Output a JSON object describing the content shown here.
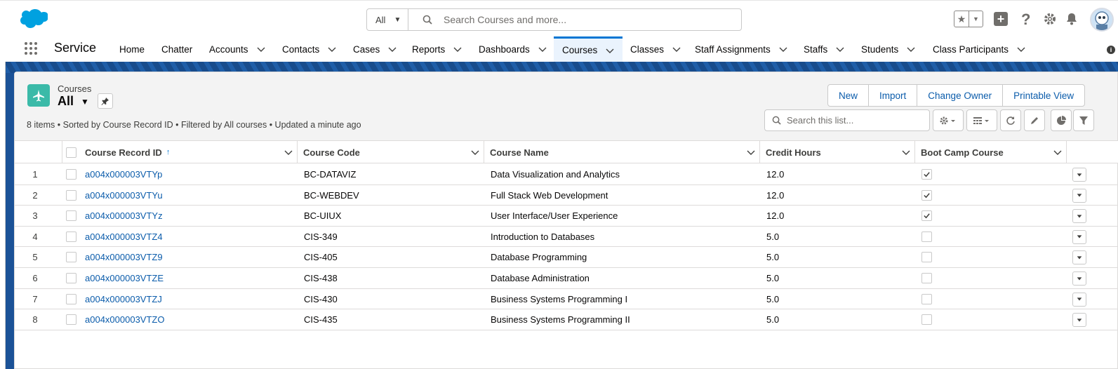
{
  "header": {
    "search_scope": "All",
    "search_placeholder": "Search Courses and more..."
  },
  "nav": {
    "app_name": "Service",
    "items": [
      {
        "label": "Home",
        "has_menu": false
      },
      {
        "label": "Chatter",
        "has_menu": false
      },
      {
        "label": "Accounts",
        "has_menu": true
      },
      {
        "label": "Contacts",
        "has_menu": true
      },
      {
        "label": "Cases",
        "has_menu": true
      },
      {
        "label": "Reports",
        "has_menu": true
      },
      {
        "label": "Dashboards",
        "has_menu": true
      },
      {
        "label": "Courses",
        "has_menu": true,
        "active": true
      },
      {
        "label": "Classes",
        "has_menu": true
      },
      {
        "label": "Staff Assignments",
        "has_menu": true
      },
      {
        "label": "Staffs",
        "has_menu": true
      },
      {
        "label": "Students",
        "has_menu": true
      },
      {
        "label": "Class Participants",
        "has_menu": true
      }
    ]
  },
  "list_view": {
    "object_label": "Courses",
    "view_name": "All",
    "meta": "8 items • Sorted by Course Record ID • Filtered by All courses • Updated a minute ago",
    "actions": [
      "New",
      "Import",
      "Change Owner",
      "Printable View"
    ],
    "search_placeholder": "Search this list..."
  },
  "table": {
    "columns": [
      "Course Record ID",
      "Course Code",
      "Course Name",
      "Credit Hours",
      "Boot Camp Course"
    ],
    "rows": [
      {
        "num": "1",
        "id": "a004x000003VTYp",
        "code": "BC-DATAVIZ",
        "name": "Data Visualization and Analytics",
        "hours": "12.0",
        "bootcamp": true
      },
      {
        "num": "2",
        "id": "a004x000003VTYu",
        "code": "BC-WEBDEV",
        "name": "Full Stack Web Development",
        "hours": "12.0",
        "bootcamp": true
      },
      {
        "num": "3",
        "id": "a004x000003VTYz",
        "code": "BC-UIUX",
        "name": "User Interface/User Experience",
        "hours": "12.0",
        "bootcamp": true
      },
      {
        "num": "4",
        "id": "a004x000003VTZ4",
        "code": "CIS-349",
        "name": "Introduction to Databases",
        "hours": "5.0",
        "bootcamp": false
      },
      {
        "num": "5",
        "id": "a004x000003VTZ9",
        "code": "CIS-405",
        "name": "Database Programming",
        "hours": "5.0",
        "bootcamp": false
      },
      {
        "num": "6",
        "id": "a004x000003VTZE",
        "code": "CIS-438",
        "name": "Database Administration",
        "hours": "5.0",
        "bootcamp": false
      },
      {
        "num": "7",
        "id": "a004x000003VTZJ",
        "code": "CIS-430",
        "name": "Business Systems Programming I",
        "hours": "5.0",
        "bootcamp": false
      },
      {
        "num": "8",
        "id": "a004x000003VTZO",
        "code": "CIS-435",
        "name": "Business Systems Programming II",
        "hours": "5.0",
        "bootcamp": false
      }
    ]
  },
  "colors": {
    "brand_blue": "#0176d3",
    "link": "#0b5cab",
    "object_icon": "#3bbaa8",
    "band": "#1b5297"
  }
}
